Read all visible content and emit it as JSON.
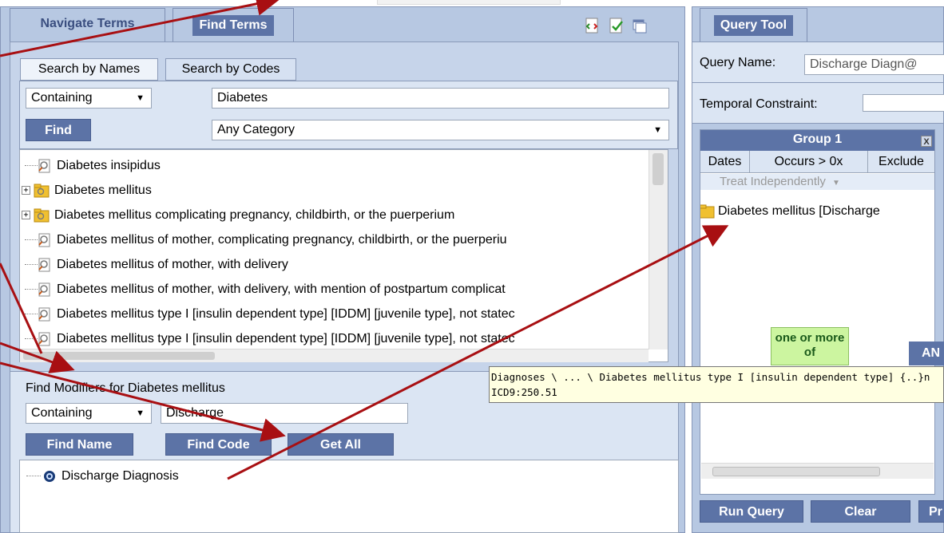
{
  "left_panel": {
    "tabs": {
      "navigate": "Navigate Terms",
      "find": "Find Terms"
    },
    "subtabs": {
      "names": "Search by Names",
      "codes": "Search by Codes"
    },
    "search_mode": "Containing",
    "search_text": "Diabetes",
    "find_button": "Find",
    "category": "Any Category",
    "results": [
      {
        "label": "Diabetes insipidus",
        "kind": "leaf"
      },
      {
        "label": "Diabetes mellitus",
        "kind": "folder"
      },
      {
        "label": "Diabetes mellitus complicating pregnancy, childbirth, or the puerperium",
        "kind": "folder"
      },
      {
        "label": "Diabetes mellitus of mother, complicating pregnancy, childbirth, or the puerperiu",
        "kind": "leaf"
      },
      {
        "label": "Diabetes mellitus of mother, with delivery",
        "kind": "leaf"
      },
      {
        "label": "Diabetes mellitus of mother, with delivery, with mention of postpartum complicat",
        "kind": "leaf"
      },
      {
        "label": "Diabetes mellitus type I [insulin dependent type] [IDDM] [juvenile type], not statec",
        "kind": "leaf"
      },
      {
        "label": "Diabetes mellitus type I [insulin dependent type] [IDDM] [juvenile type], not statec",
        "kind": "leaf"
      }
    ],
    "modifiers": {
      "title": "Find Modifiers for Diabetes mellitus",
      "mode": "Containing",
      "text": "Discharge",
      "find_name": "Find Name",
      "find_code": "Find Code",
      "get_all": "Get All",
      "results": [
        "Discharge Diagnosis"
      ]
    }
  },
  "query_tool": {
    "tab": "Query Tool",
    "query_name_label": "Query Name:",
    "query_name_value": "Discharge Diagn@",
    "temporal_label": "Temporal Constraint:",
    "group": {
      "title": "Group 1",
      "close": "X",
      "cols": [
        "Dates",
        "Occurs > 0x",
        "Exclude"
      ],
      "treat": "Treat Independently",
      "item": "Diabetes mellitus [Discharge",
      "one_or_more": "one or more of",
      "and": "AN"
    },
    "buttons": {
      "run": "Run Query",
      "clear": "Clear",
      "pr": "Pr"
    }
  },
  "tooltip": {
    "line1": "Diagnoses \\ ... \\ Diabetes mellitus type I [insulin dependent type] {..}n",
    "line2": "ICD9:250.51"
  },
  "colors": {
    "panel": "#b7c8e2",
    "button": "#5c73a6",
    "arrow": "#a80f12",
    "green": "#ccf5a0"
  }
}
